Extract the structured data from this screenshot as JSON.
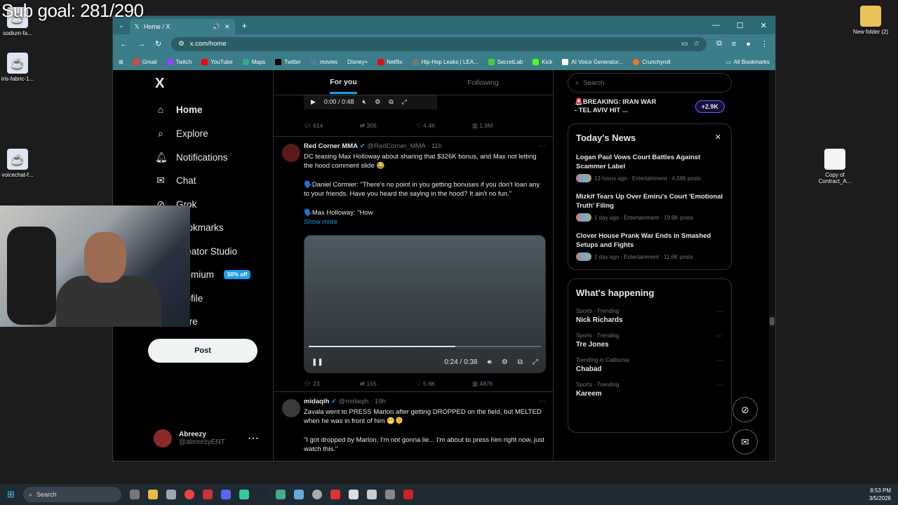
{
  "overlay": {
    "goal_text": "Sub goal: 281/290"
  },
  "desktop": {
    "icons": [
      "sodium-fa...",
      "iris-fabric-1...",
      "voicechat-f...",
      "New folder (2)",
      "Copy of Contract_A..."
    ]
  },
  "browser": {
    "tab_title": "Home / X",
    "url": "x.com/home",
    "bookmarks": [
      "Gmail",
      "Twitch",
      "YouTube",
      "Maps",
      "Twitter",
      "movies",
      "Disney+",
      "Netflix",
      "Hip-Hop Leaks | LEA...",
      "SecretLab",
      "Kick",
      "AI Voice Generator...",
      "Crunchyroll",
      "All Bookmarks"
    ]
  },
  "nav": {
    "logo": "X",
    "items": [
      "Home",
      "Explore",
      "Notifications",
      "Chat",
      "Grok",
      "Bookmarks",
      "Creator Studio",
      "Premium",
      "Profile",
      "More"
    ],
    "premium_badge": "50% off",
    "post_button": "Post",
    "profile_name": "Abreezy",
    "profile_handle": "@abreezyENT"
  },
  "feed": {
    "tabs": [
      "For you",
      "Following"
    ],
    "top_video_time": "0:00 / 0:48",
    "top_actions": [
      "614",
      "306",
      "4.4K",
      "1.9M"
    ],
    "tweet1": {
      "name": "Red Corner MMA",
      "handle": "@RedCorner_MMA",
      "time": "· 11h",
      "line1": "DC teasing Max Holloway about sharing that $326K bonus, and Max not letting the hood comment slide 😂",
      "line2": "🗣️Daniel Cormier: \"There's no point in you getting bonuses if you don't loan any to your friends. Have you heard the saying in the hood? It ain't no fun.\"",
      "line3": "🗣️Max Holloway: \"How",
      "show_more": "Show more",
      "video_time": "0:24 / 0:38",
      "actions": [
        "23",
        "155",
        "5.6K",
        "487K"
      ]
    },
    "tweet2": {
      "name": "midaqih",
      "handle": "@midaqih",
      "time": "· 19h",
      "line1": "Zavala went to PRESS Marlon after getting DROPPED on the field, but MELTED when he was in front of him 😬🫠",
      "line2": "\"I got dropped by Marlon, I'm not gonna lie... I'm about to press him right now, just watch this.\""
    }
  },
  "sidebar": {
    "search_placeholder": "Search",
    "breaking": "🚨BREAKING: IRAN WAR - TEL AVIV HIT ...",
    "breaking_count": "+2.9K",
    "news_title": "Today's News",
    "news": [
      {
        "title": "Logan Paul Vows Court Battles Against Scammer Label",
        "meta": "13 hours ago · Entertainment · 4,586 posts"
      },
      {
        "title": "Mizkif Tears Up Over Emiru's Court 'Emotional Truth' Filing",
        "meta": "1 day ago · Entertainment · 19.9K posts"
      },
      {
        "title": "Clover House Prank War Ends in Smashed Setups and Fights",
        "meta": "1 day ago · Entertainment · 11.6K posts"
      }
    ],
    "happening_title": "What's happening",
    "trends": [
      {
        "cat": "Sports · Trending",
        "name": "Nick Richards"
      },
      {
        "cat": "Sports · Trending",
        "name": "Tre Jones"
      },
      {
        "cat": "Trending in California",
        "name": "Chabad"
      },
      {
        "cat": "Sports · Trending",
        "name": "Kareem"
      }
    ]
  },
  "taskbar": {
    "search": "Search",
    "time": "8:53 PM",
    "date": "3/5/2026"
  }
}
